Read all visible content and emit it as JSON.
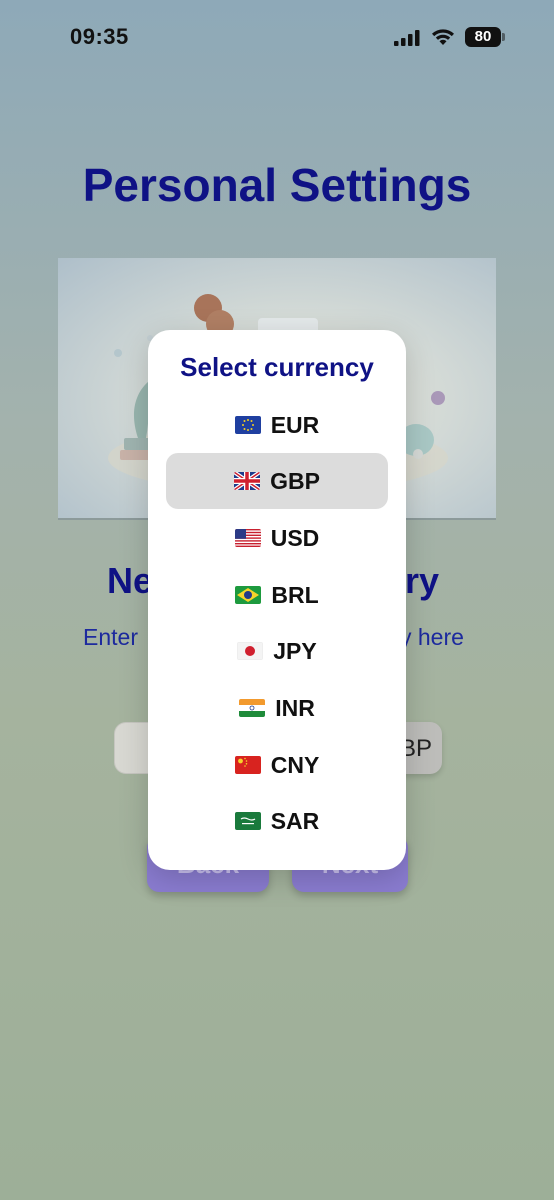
{
  "status": {
    "time": "09:35",
    "battery": "80"
  },
  "header": {
    "title": "Personal Settings"
  },
  "section": {
    "title_left": "Ne",
    "title_right": "ry",
    "subtitle_left": "Enter",
    "subtitle_right": "y here"
  },
  "form": {
    "currency_value": "BP"
  },
  "buttons": {
    "back": "Back",
    "next": "Next"
  },
  "modal": {
    "title": "Select currency",
    "selected": "GBP",
    "options": [
      {
        "code": "EUR",
        "flag": "eu-flag-icon"
      },
      {
        "code": "GBP",
        "flag": "uk-flag-icon"
      },
      {
        "code": "USD",
        "flag": "us-flag-icon"
      },
      {
        "code": "BRL",
        "flag": "brazil-flag-icon"
      },
      {
        "code": "JPY",
        "flag": "japan-flag-icon"
      },
      {
        "code": "INR",
        "flag": "india-flag-icon"
      },
      {
        "code": "CNY",
        "flag": "china-flag-icon"
      },
      {
        "code": "SAR",
        "flag": "saudi-flag-icon"
      }
    ]
  },
  "colors": {
    "title": "#0f1285",
    "button": "#8a7cd0",
    "selected_option": "#dcdcdc"
  }
}
